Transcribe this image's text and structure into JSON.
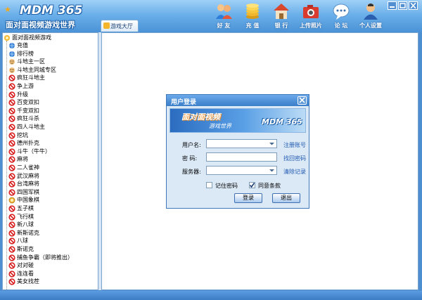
{
  "app": {
    "logo_mark": "★",
    "logo_brand": "MDM 365",
    "logo_tagline": "面对面视频游戏世界"
  },
  "tabs": [
    {
      "label": "游戏大厅"
    }
  ],
  "toolbar": [
    {
      "label": "好 友",
      "icon": "friends-icon"
    },
    {
      "label": "充 值",
      "icon": "coins-icon"
    },
    {
      "label": "银 行",
      "icon": "bank-icon"
    },
    {
      "label": "上传照片",
      "icon": "camera-icon"
    },
    {
      "label": "论 坛",
      "icon": "forum-icon"
    },
    {
      "label": "个人设置",
      "icon": "settings-icon"
    }
  ],
  "window_controls": [
    "minimize",
    "maximize",
    "close"
  ],
  "tree": {
    "root": "面对面视频游戏",
    "items": [
      {
        "label": "充值",
        "icon": "globe"
      },
      {
        "label": "排行榜",
        "icon": "globe"
      },
      {
        "label": "斗地主一区",
        "icon": "face"
      },
      {
        "label": "斗地主同城专区",
        "icon": "face"
      },
      {
        "label": "疯狂斗地主",
        "icon": "no"
      },
      {
        "label": "争上游",
        "icon": "no"
      },
      {
        "label": "升级",
        "icon": "no"
      },
      {
        "label": "百变双扣",
        "icon": "no"
      },
      {
        "label": "千变双扣",
        "icon": "no"
      },
      {
        "label": "疯狂斗杀",
        "icon": "no"
      },
      {
        "label": "四人斗地主",
        "icon": "no"
      },
      {
        "label": "挖坑",
        "icon": "no"
      },
      {
        "label": "德州扑克",
        "icon": "no"
      },
      {
        "label": "斗牛（牛牛）",
        "icon": "no"
      },
      {
        "label": "麻将",
        "icon": "no"
      },
      {
        "label": "二人雀神",
        "icon": "no"
      },
      {
        "label": "武汉麻将",
        "icon": "no"
      },
      {
        "label": "台湾麻将",
        "icon": "no"
      },
      {
        "label": "四国军棋",
        "icon": "no"
      },
      {
        "label": "中国象棋",
        "icon": "chess"
      },
      {
        "label": "五子棋",
        "icon": "no"
      },
      {
        "label": "飞行棋",
        "icon": "no"
      },
      {
        "label": "新八球",
        "icon": "no"
      },
      {
        "label": "新斯诺克",
        "icon": "no"
      },
      {
        "label": "八球",
        "icon": "no"
      },
      {
        "label": "斯诺克",
        "icon": "no"
      },
      {
        "label": "捕鱼争霸（即将推出）",
        "icon": "no"
      },
      {
        "label": "对对碰",
        "icon": "no"
      },
      {
        "label": "连连看",
        "icon": "no"
      },
      {
        "label": "美女找茬",
        "icon": "no"
      }
    ]
  },
  "dialog": {
    "title": "用户登录",
    "banner_title": "面对面视频",
    "banner_sub": "游戏世界",
    "banner_brand": "MDM 365",
    "username_label": "用户名:",
    "username_value": "",
    "password_label": "密   码:",
    "password_value": "",
    "server_label": "服务器:",
    "server_value": "",
    "register_link": "注册账号",
    "recover_link": "找回密码",
    "clear_link": "清除记录",
    "remember_label": "记住密码",
    "remember_checked": false,
    "agree_label": "同意条款",
    "agree_checked": true,
    "login_button": "登录",
    "exit_button": "退出"
  }
}
